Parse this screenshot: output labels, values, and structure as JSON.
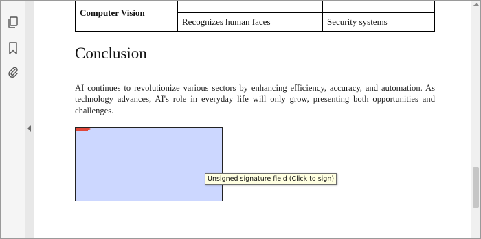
{
  "sidebar": {
    "icons": [
      "pages-icon",
      "bookmark-icon",
      "attachment-icon"
    ]
  },
  "table": {
    "row": {
      "category": "Computer Vision",
      "application": "Recognizes human faces",
      "use_case": "Security systems"
    }
  },
  "document": {
    "heading": "Conclusion",
    "paragraph": "AI continues to revolutionize various sectors by enhancing efficiency, accuracy, and automation. As technology advances, AI's role in everyday life will only grow, presenting both opportunities and challenges."
  },
  "signature_field": {
    "tooltip": "Unsigned signature field (Click to sign)",
    "fill_color": "#ccd7ff",
    "flag_color": "#e0473a"
  }
}
